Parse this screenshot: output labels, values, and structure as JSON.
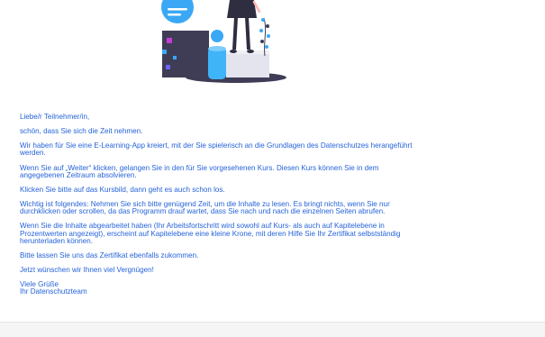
{
  "colors": {
    "text": "#2563d9",
    "accent_blue": "#3aa8f5",
    "illustration_dark": "#3f3d56",
    "footer_bg": "#f5f5f5"
  },
  "course_image": {
    "icon": "e-learning-illustration"
  },
  "message": {
    "greeting": "Liebe/r Teilnehmer/in,",
    "body": [
      [
        "schön, dass Sie sich die Zeit nehmen."
      ],
      [
        "Wir haben für Sie eine E-Learning-App kreiert, mit der Sie spielerisch an die Grundlagen des Datenschutzes herangeführt",
        "werden."
      ],
      [
        "Wenn Sie auf „Weiter“ klicken, gelangen Sie in den für Sie vorgesehenen Kurs. Diesen Kurs können Sie in dem",
        "angegebenen Zeitraum absolvieren."
      ],
      [
        "Klicken Sie bitte auf das Kursbild, dann geht es auch schon los."
      ],
      [
        "Wichtig ist folgendes: Nehmen Sie sich bitte genügend Zeit, um die Inhalte zu lesen. Es bringt nichts, wenn Sie nur",
        "durchklicken oder scrollen, da das Programm drauf wartet, dass Sie nach und nach die einzelnen Seiten abrufen."
      ],
      [
        "Wenn Sie die Inhalte abgearbeitet haben (Ihr Arbeitsfortschritt wird sowohl auf Kurs- als auch auf Kapitelebene in",
        "Prozentwerten angezeigt), erscheint auf Kapitelebene eine kleine Krone, mit deren Hilfe Sie Ihr Zertifikat selbstständig",
        "herunterladen können."
      ],
      [
        "Bitte lassen Sie uns das Zertifikat ebenfalls zukommen."
      ],
      [
        "Jetzt wünschen wir Ihnen viel Vergnügen!"
      ]
    ],
    "sign_off": [
      "Viele Grüße",
      "Ihr Datenschutzteam"
    ]
  }
}
